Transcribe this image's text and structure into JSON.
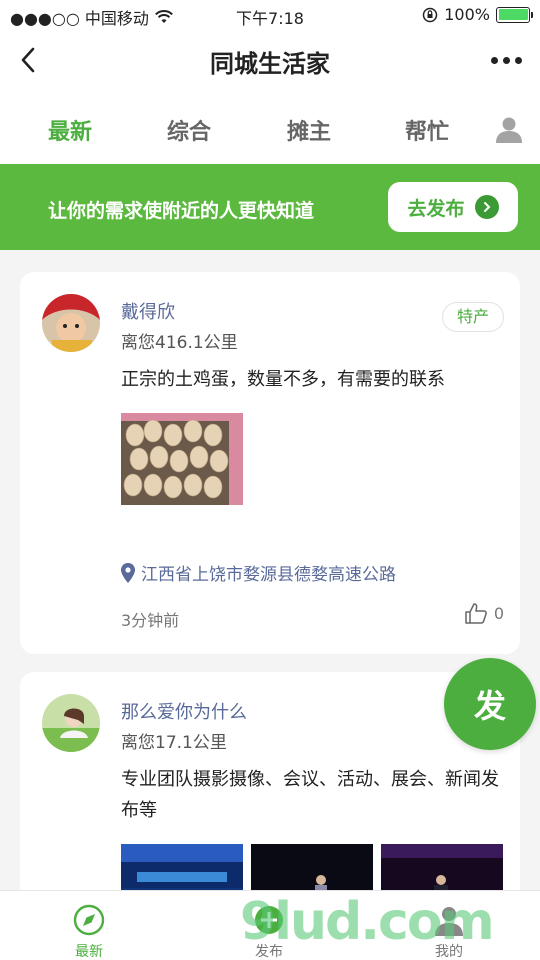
{
  "status": {
    "carrier": "●●●○○ 中国移动",
    "time": "下午7:18",
    "battery": "100%"
  },
  "nav": {
    "title": "同城生活家"
  },
  "tabs": [
    "最新",
    "综合",
    "摊主",
    "帮忙"
  ],
  "banner": {
    "text": "让你的需求使附近的人更快知道",
    "button": "去发布"
  },
  "posts": [
    {
      "name": "戴得欣",
      "distance": "离您416.1公里",
      "tag": "特产",
      "content": "正宗的土鸡蛋，数量不多，有需要的联系",
      "location": "江西省上饶市婺源县德婺高速公路",
      "time": "3分钟前",
      "likes": "0"
    },
    {
      "name": "那么爱你为什么",
      "distance": "离您17.1公里",
      "content": "专业团队摄影摄像、会议、活动、展会、新闻发布等"
    }
  ],
  "fab": "发",
  "tabbar": [
    {
      "label": "最新",
      "icon": "compass-icon"
    },
    {
      "label": "发布",
      "icon": "plus-icon"
    },
    {
      "label": "我的",
      "icon": "user-icon"
    }
  ],
  "watermark": "9lud.com",
  "colors": {
    "accent": "#4cae3f",
    "banner": "#5cb940",
    "link": "#5a6b9a"
  }
}
